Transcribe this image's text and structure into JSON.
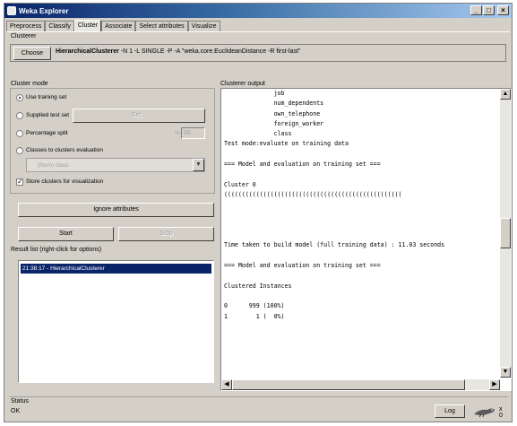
{
  "window": {
    "title": "Weka Explorer",
    "controls": {
      "minimize": "_",
      "maximize": "□",
      "close": "×"
    }
  },
  "tabs": [
    {
      "label": "Preprocess",
      "active": false
    },
    {
      "label": "Classify",
      "active": false
    },
    {
      "label": "Cluster",
      "active": true
    },
    {
      "label": "Associate",
      "active": false
    },
    {
      "label": "Select attributes",
      "active": false
    },
    {
      "label": "Visualize",
      "active": false
    }
  ],
  "clusterer": {
    "label": "Clusterer",
    "choose_label": "Choose",
    "scheme_name": "HierarchicalClusterer",
    "scheme_args": " -N 1 -L SINGLE -P -A \"weka.core.EuclideanDistance -R first-last\""
  },
  "cluster_mode": {
    "label": "Cluster mode",
    "options": [
      {
        "label": "Use training set",
        "checked": true
      },
      {
        "label": "Supplied test set",
        "checked": false
      },
      {
        "label": "Percentage split",
        "checked": false
      },
      {
        "label": "Classes to clusters evaluation",
        "checked": false
      }
    ],
    "set_button": "Set...",
    "percent_suffix": "%",
    "percent_value": "66",
    "class_select": "(Nom) class",
    "store_clusters_label": "Store clusters for visualization",
    "store_clusters_checked": true
  },
  "ignore_attributes_label": "Ignore attributes",
  "start_label": "Start",
  "stop_label": "Stop",
  "result_list": {
    "label": "Result list (right-click for options)",
    "items": [
      "21:38:17 - HierarchicalClusterer"
    ]
  },
  "output": {
    "label": "Clusterer output",
    "lines": [
      "              job",
      "              num_dependents",
      "              own_telephone",
      "              foreign_worker",
      "              class",
      "Test mode:evaluate on training data",
      "",
      "=== Model and evaluation on training set ===",
      "",
      "Cluster 0",
      "((((((((((((((((((((((((((((((((((((((((((((((((((",
      "",
      "",
      "",
      "",
      "Time taken to build model (full training data) : 11.03 seconds",
      "",
      "=== Model and evaluation on training set ===",
      "",
      "Clustered Instances",
      "",
      "0      999 (100%)",
      "1        1 (  0%)"
    ]
  },
  "status": {
    "label": "Status",
    "text": "OK"
  },
  "log_label": "Log",
  "x_count": "x 0",
  "icons": {
    "scroll_up": "▲",
    "scroll_down": "▼",
    "scroll_left": "◀",
    "scroll_right": "▶",
    "combo_arrow": "▼",
    "checkmark": "✓"
  },
  "colors": {
    "title_start": "#0a246a",
    "title_end": "#a6caf0",
    "selection": "#0a246a",
    "face": "#d4d0c8"
  }
}
